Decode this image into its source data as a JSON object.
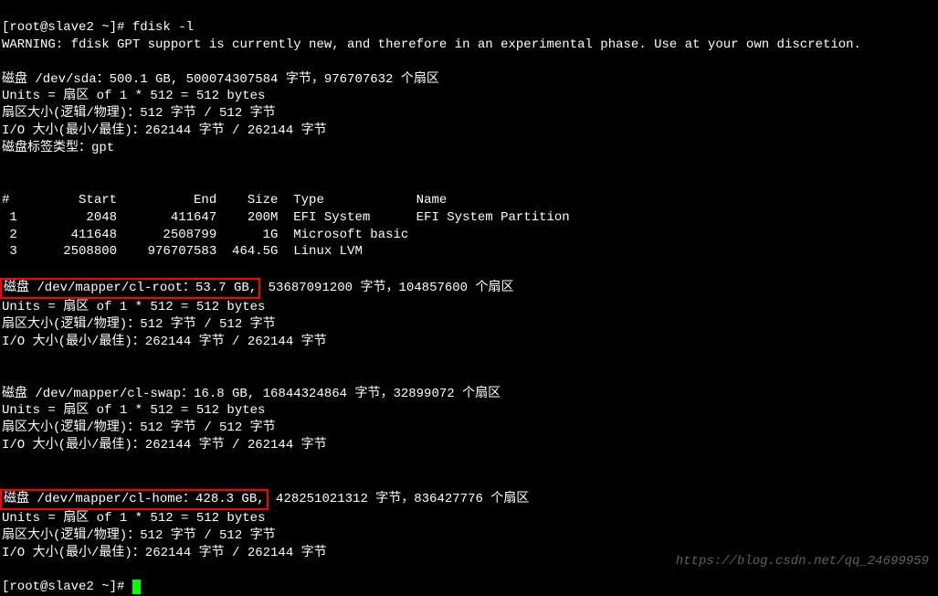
{
  "prompt1": "[root@slave2 ~]# ",
  "command": "fdisk -l",
  "warning": "WARNING: fdisk GPT support is currently new, and therefore in an experimental phase. Use at your own discretion.",
  "disk_sda": {
    "line1": "磁盘 /dev/sda：500.1 GB, 500074307584 字节，976707632 个扇区",
    "units": "Units = 扇区 of 1 * 512 = 512 bytes",
    "sector_size": "扇区大小(逻辑/物理)：512 字节 / 512 字节",
    "io_size": "I/O 大小(最小/最佳)：262144 字节 / 262144 字节",
    "label_type": "磁盘标签类型：gpt"
  },
  "partition_table": {
    "header": "#         Start          End    Size  Type            Name",
    "rows": [
      " 1         2048       411647    200M  EFI System      EFI System Partition",
      " 2       411648      2508799      1G  Microsoft basic ",
      " 3      2508800    976707583  464.5G  Linux LVM       "
    ]
  },
  "disk_cl_root": {
    "line1_boxed": "磁盘 /dev/mapper/cl-root：53.7 GB,",
    "line1_rest": " 53687091200 字节，104857600 个扇区",
    "units": "Units = 扇区 of 1 * 512 = 512 bytes",
    "sector_size": "扇区大小(逻辑/物理)：512 字节 / 512 字节",
    "io_size": "I/O 大小(最小/最佳)：262144 字节 / 262144 字节"
  },
  "disk_cl_swap": {
    "line1": "磁盘 /dev/mapper/cl-swap：16.8 GB, 16844324864 字节，32899072 个扇区",
    "units": "Units = 扇区 of 1 * 512 = 512 bytes",
    "sector_size": "扇区大小(逻辑/物理)：512 字节 / 512 字节",
    "io_size": "I/O 大小(最小/最佳)：262144 字节 / 262144 字节"
  },
  "disk_cl_home": {
    "line1_boxed": "磁盘 /dev/mapper/cl-home：428.3 GB,",
    "line1_rest": " 428251021312 字节，836427776 个扇区",
    "units": "Units = 扇区 of 1 * 512 = 512 bytes",
    "sector_size": "扇区大小(逻辑/物理)：512 字节 / 512 字节",
    "io_size": "I/O 大小(最小/最佳)：262144 字节 / 262144 字节"
  },
  "prompt2": "[root@slave2 ~]# ",
  "watermark": "https://blog.csdn.net/qq_24699959"
}
